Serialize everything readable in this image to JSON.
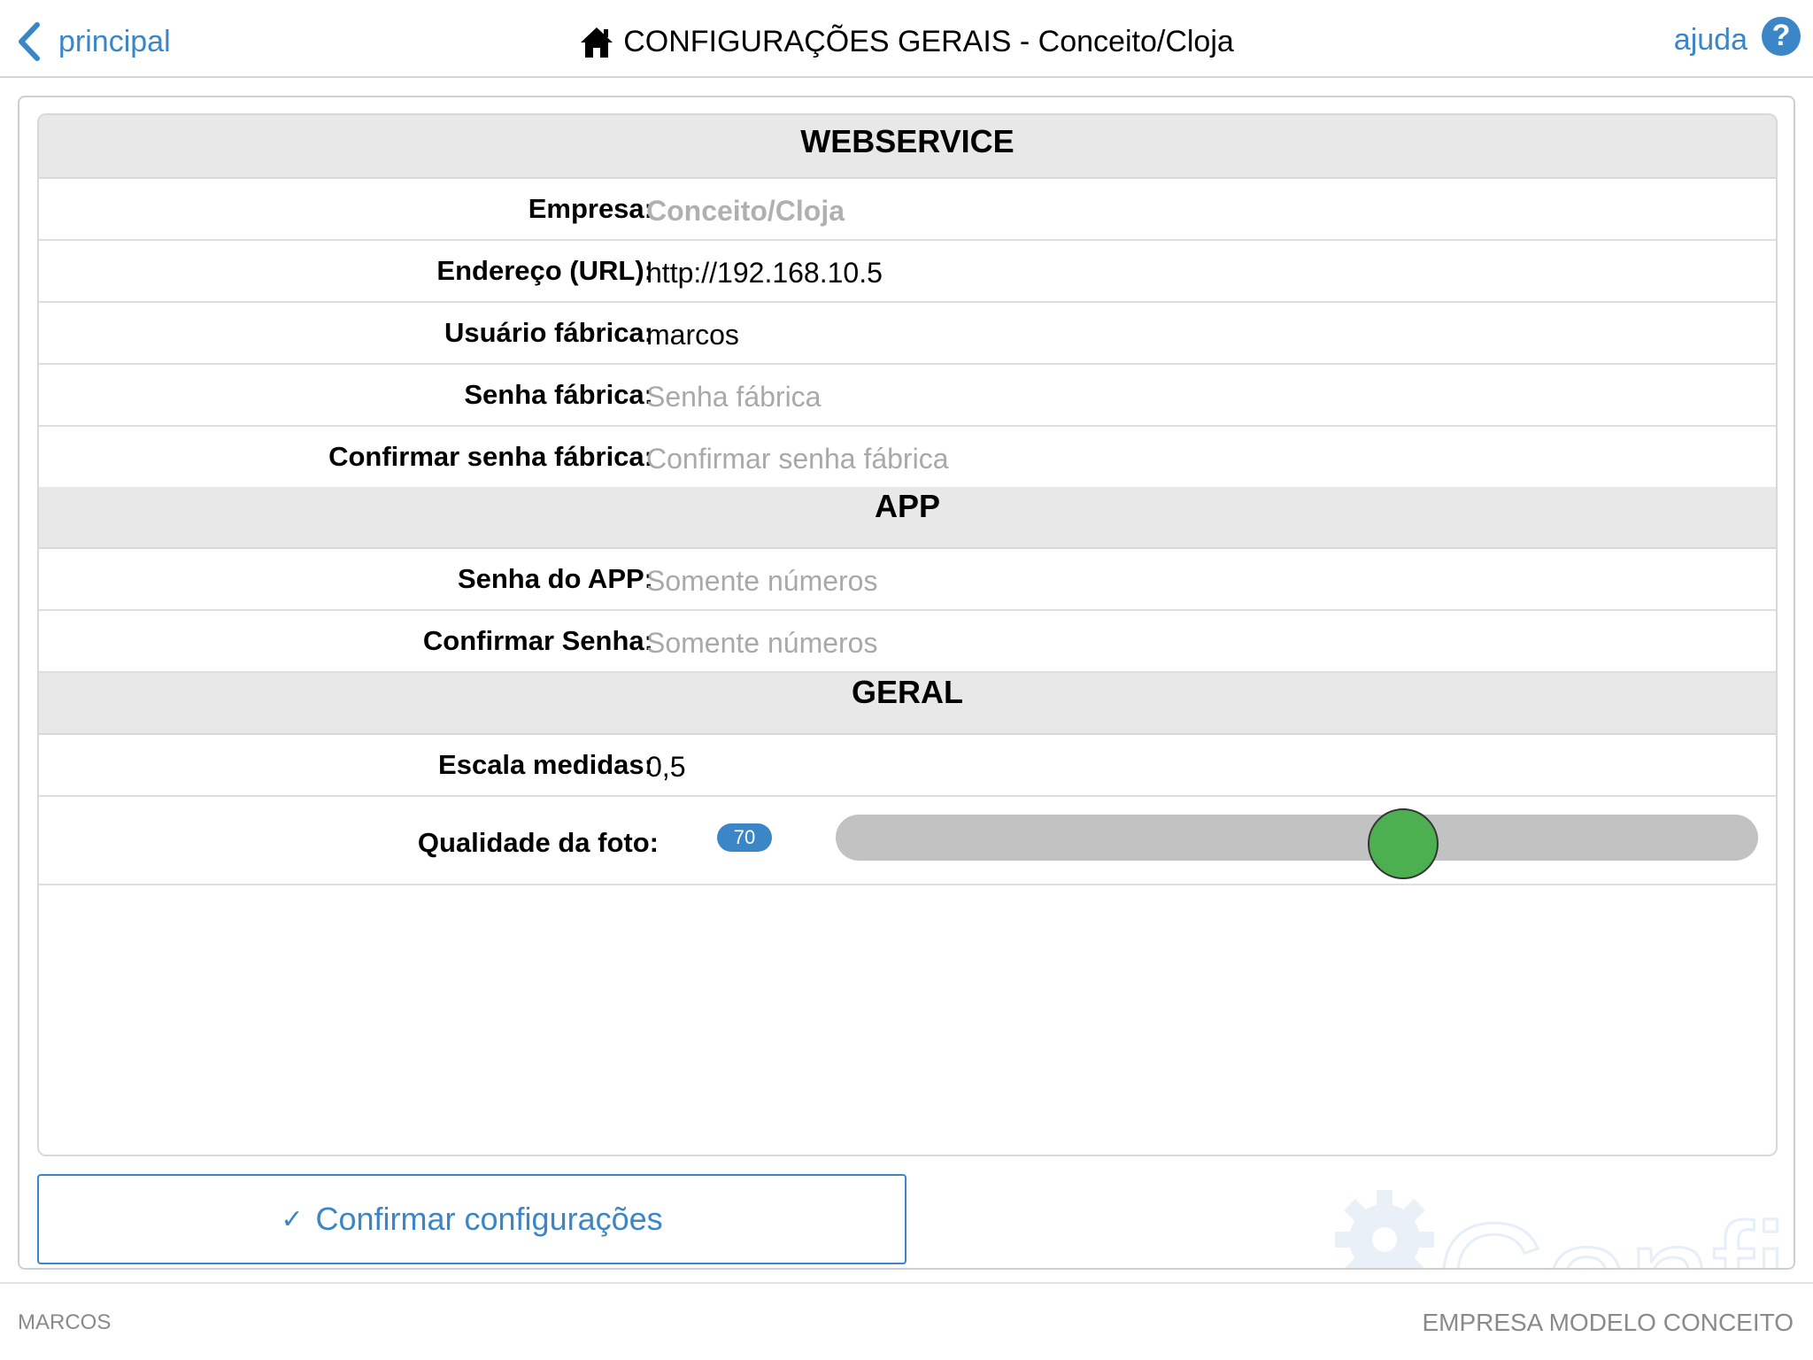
{
  "nav": {
    "back_label": "principal",
    "title": "CONFIGURAÇÕES GERAIS - Conceito/Cloja",
    "help_label": "ajuda",
    "help_symbol": "?"
  },
  "sections": {
    "webservice": "WEBSERVICE",
    "app": "APP",
    "geral": "GERAL"
  },
  "webservice": {
    "empresa_label": "Empresa:",
    "empresa_value": "Conceito/Cloja",
    "url_label": "Endereço (URL):",
    "url_value": "http://192.168.10.5",
    "usuario_label": "Usuário fábrica:",
    "usuario_value": "marcos",
    "senha_label": "Senha fábrica:",
    "senha_placeholder": "Senha fábrica",
    "confirmar_label": "Confirmar senha fábrica:",
    "confirmar_placeholder": "Confirmar senha fábrica"
  },
  "app": {
    "senha_label": "Senha do APP:",
    "senha_placeholder": "Somente números",
    "confirmar_label": "Confirmar Senha:",
    "confirmar_placeholder": "Somente números"
  },
  "geral": {
    "escala_label": "Escala medidas:",
    "escala_value": "0,5",
    "qualidade_label": "Qualidade da foto:",
    "qualidade_value": "70",
    "qualidade_fraction": 0.615
  },
  "actions": {
    "confirm_label": "Confirmar configurações",
    "confirm_icon": "check-icon"
  },
  "watermark": {
    "text": "Config"
  },
  "footer": {
    "user": "MARCOS",
    "company": "EMPRESA MODELO CONCEITO"
  },
  "colors": {
    "accent": "#3b86c6",
    "thumb": "#4caf50",
    "section_bg": "#e8e8e8"
  }
}
